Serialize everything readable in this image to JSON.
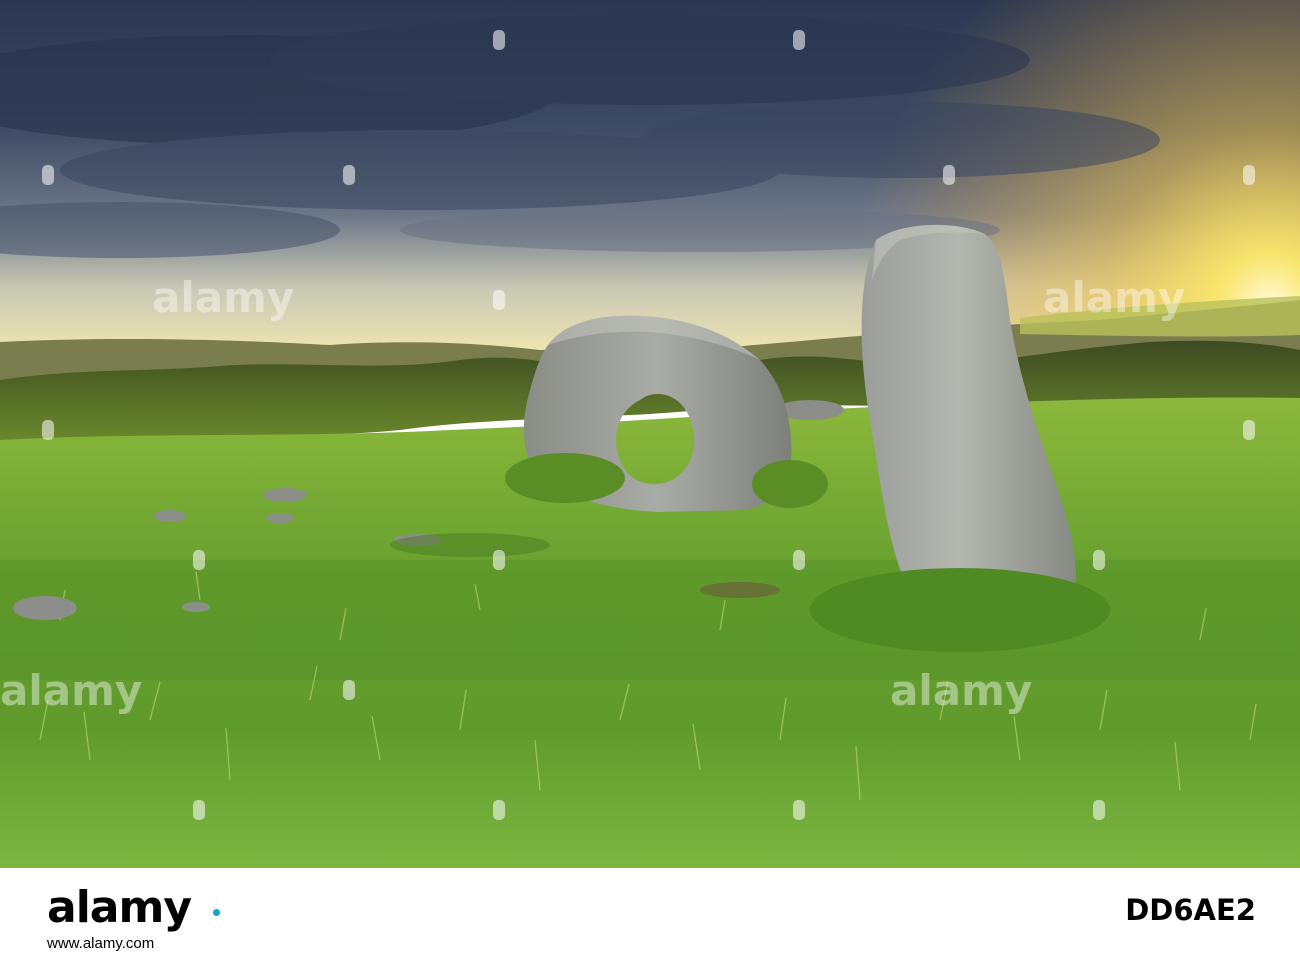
{
  "footer": {
    "brand": "alamy",
    "image_id": "DD6AE2",
    "domain": "www.alamy.com"
  },
  "watermark": {
    "text": "alamy"
  },
  "scene": {
    "subject": "holed-stone-and-standing-stone",
    "colors": {
      "sky_dark": "#2e3a4f",
      "sky_glow": "#f7e25a",
      "grass": "#7fb73a",
      "stone": "#a4a7a2"
    }
  }
}
